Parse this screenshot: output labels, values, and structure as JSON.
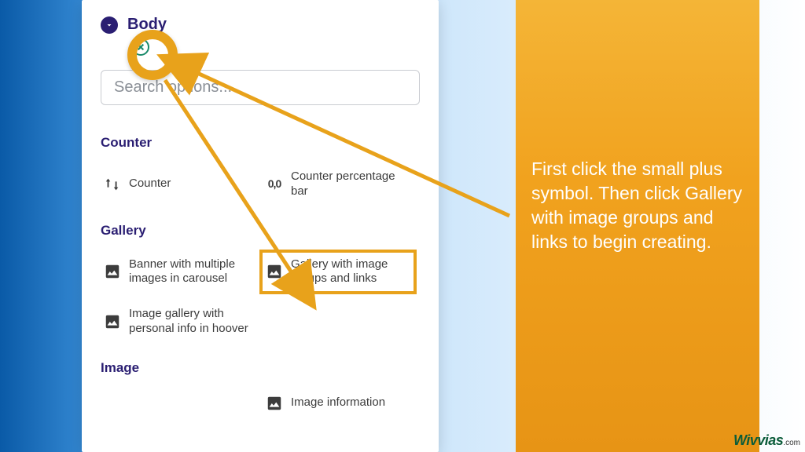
{
  "header": {
    "section_label": "Body"
  },
  "search": {
    "placeholder": "Search options..."
  },
  "groups": {
    "counter": {
      "label": "Counter",
      "items": [
        {
          "label": "Counter",
          "icon": "sort"
        },
        {
          "label": "Counter percentage bar",
          "icon": "zero"
        }
      ]
    },
    "gallery": {
      "label": "Gallery",
      "items": [
        {
          "label": "Banner with multiple images in carousel",
          "icon": "image"
        },
        {
          "label": "Gallery with image groups and links",
          "icon": "image"
        },
        {
          "label": "Image gallery with personal info in hoover",
          "icon": "image"
        }
      ]
    },
    "image": {
      "label": "Image",
      "items": [
        {
          "label": "Image information",
          "icon": "image"
        }
      ]
    }
  },
  "explanation": "First click the small plus symbol. Then click Gallery with image groups and links to begin creating.",
  "brand": {
    "name": "Wivvias",
    "tld": ".com"
  }
}
